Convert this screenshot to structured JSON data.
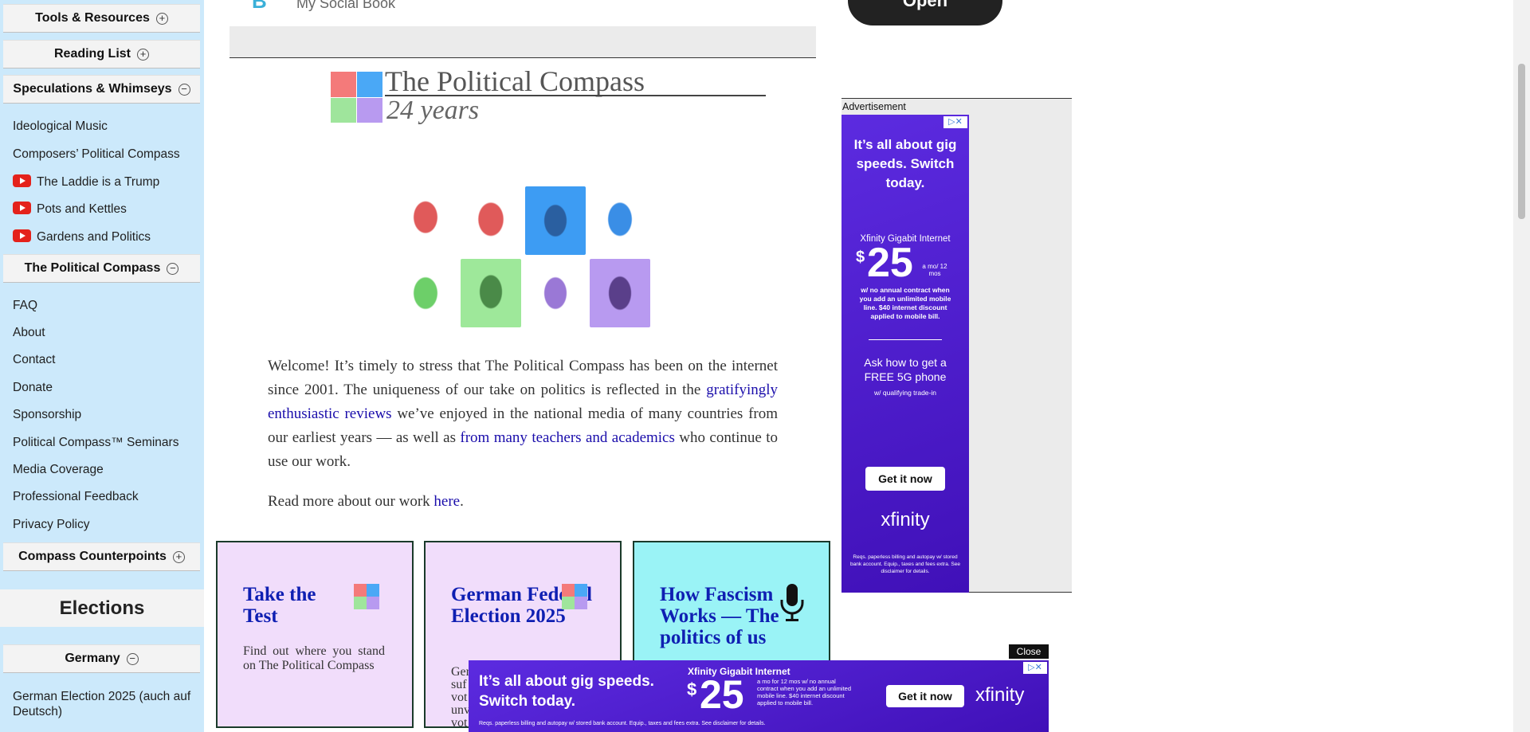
{
  "sidebar": {
    "sections": {
      "tools": "Tools & Resources",
      "reading": "Reading List",
      "speculations": "Speculations & Whimseys",
      "compass": "The Political Compass",
      "counterpoints": "Compass Counterpoints",
      "germany": "Germany"
    },
    "speculations_items": [
      {
        "label": "Ideological Music"
      },
      {
        "label": "Composers’ Political Compass"
      },
      {
        "label": "The Laddie is a Trump"
      },
      {
        "label": "Pots and Kettles"
      },
      {
        "label": "Gardens and Politics"
      }
    ],
    "compass_items": [
      {
        "label": "FAQ"
      },
      {
        "label": "About"
      },
      {
        "label": "Contact"
      },
      {
        "label": "Donate"
      },
      {
        "label": "Sponsorship"
      },
      {
        "label": "Political Compass™ Seminars"
      },
      {
        "label": "Media Coverage"
      },
      {
        "label": "Professional Feedback"
      },
      {
        "label": "Privacy Policy"
      }
    ],
    "elections_heading": "Elections",
    "germany_items": [
      {
        "label": "German Election 2025 (auch auf Deutsch)"
      }
    ],
    "plus": "+",
    "minus": "−"
  },
  "top": {
    "partial_link": "My Social Book",
    "partial_button": "Open"
  },
  "logo": {
    "title": "The Political Compass",
    "subtitle": "24 years"
  },
  "intro": {
    "p1_a": "Welcome! It’s timely to stress that The Political Compass has been on the internet since 2001. The uniqueness of our take on politics is reflected in the ",
    "p1_link1": "gratifyingly enthusiastic reviews",
    "p1_b": " we’ve enjoyed in the national media of many countries from our earliest years — as well as ",
    "p1_link2": "from many teachers and academics",
    "p1_c": " who continue to use our work.",
    "p2_a": "Read more about our work ",
    "p2_link": "here",
    "p2_b": "."
  },
  "cards": [
    {
      "title": "Take the Test",
      "text": "Find out where you stand on The Political Compass",
      "color": "#f1ddfb"
    },
    {
      "title": "German Federal Election 2025",
      "text": "Ger suf vot unv vot",
      "color": "#f1ddfb"
    },
    {
      "title": "How Fascism Works — The politics of us",
      "text": "",
      "color": "#9af3f6"
    }
  ],
  "ad_side": {
    "label": "Advertisement",
    "headline": "It’s all about gig speeds. Switch today.",
    "product": "Xfinity Gigabit Internet",
    "price_symbol": "$",
    "price": "25",
    "price_note": "a mo/ 12 mos",
    "fine1": "w/ no annual contract when you add an unlimited mobile line. $40 internet discount applied to mobile bill.",
    "offer": "Ask how to get a FREE 5G phone",
    "offer_note": "w/ qualifying trade-in",
    "cta": "Get it now",
    "brand": "xfinity",
    "disclaimer": "Reqs. paperless billing and autopay w/ stored bank account. Equip., taxes and fees extra. See disclaimer for details."
  },
  "ad_bottom": {
    "close": "Close",
    "headline": "It’s all about gig speeds. Switch today.",
    "product": "Xfinity Gigabit Internet",
    "price_symbol": "$",
    "price": "25",
    "price_note": "a mo for 12 mos w/ no annual contract when you add an unlimited mobile line. $40 internet discount applied to mobile bill.",
    "cta": "Get it now",
    "brand": "xfinity",
    "disclaimer": "Reqs. paperless billing and autopay w/ stored bank account. Equip., taxes and fees extra. See disclaimer for details."
  },
  "colors": {
    "sidebar_bg": "#cce9fb",
    "link": "#1a0dab",
    "card_title": "#0f1fb2",
    "red": "#f47a7a",
    "blue": "#4aa8f6",
    "green": "#9fe59c",
    "purple": "#b89af0",
    "ad_purple": "#5c2be0"
  }
}
